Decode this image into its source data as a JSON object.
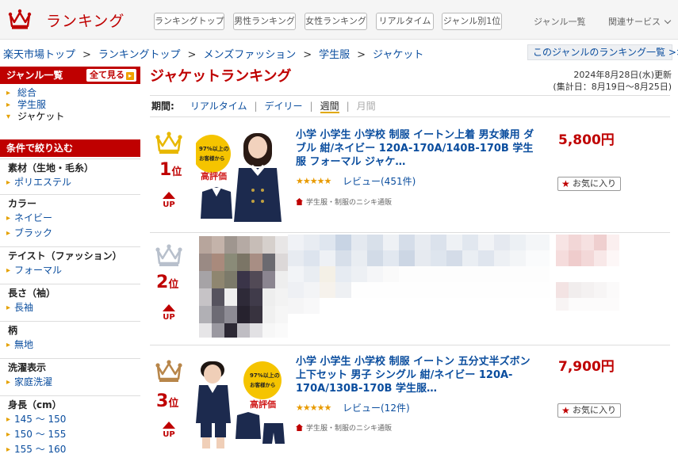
{
  "header": {
    "logo_text": "ランキング",
    "nav_buttons": [
      "ランキングトップ",
      "男性ランキング",
      "女性ランキング",
      "リアルタイム",
      "ジャンル別1位"
    ],
    "nav_links": [
      "ジャンル一覧",
      "関連サービス"
    ]
  },
  "breadcrumb": {
    "items": [
      "楽天市場トップ",
      "ランキングトップ",
      "メンズファッション",
      "学生服",
      "ジャケット"
    ],
    "separator": ">",
    "genre_ranking_link": "このジャンルのランキング一覧 >>"
  },
  "sidebar": {
    "genre_header": "ジャンル一覧",
    "see_all": "全て見る",
    "genres": [
      "総合",
      "学生服",
      "ジャケット"
    ],
    "filter_header": "条件で絞り込む",
    "filters": [
      {
        "title": "素材（生地・毛糸）",
        "options": [
          "ポリエステル"
        ]
      },
      {
        "title": "カラー",
        "options": [
          "ネイビー",
          "ブラック"
        ]
      },
      {
        "title": "テイスト（ファッション）",
        "options": [
          "フォーマル"
        ]
      },
      {
        "title": "長さ（袖）",
        "options": [
          "長袖"
        ]
      },
      {
        "title": "柄",
        "options": [
          "無地"
        ]
      },
      {
        "title": "洗濯表示",
        "options": [
          "家庭洗濯"
        ]
      },
      {
        "title": "身長（cm）",
        "options": [
          "145 ～ 150",
          "150 ～ 155",
          "155 ～ 160"
        ]
      }
    ]
  },
  "main": {
    "title": "ジャケットランキング",
    "updated": "2024年8月28日(水)更新",
    "period_note": "(集計日：8月19日～8月25日)",
    "period_label": "期間:",
    "periods": [
      "リアルタイム",
      "デイリー",
      "週間",
      "月間"
    ],
    "items": [
      {
        "rank": "1",
        "rank_suffix": "位",
        "trend": "UP",
        "name": "小学 小学生 小学校 制服 イートン上着 男女兼用 ダブル 紺/ネイビー 120A-170A/140B-170B 学生服 フォーマル ジャケ…",
        "price": "5,800円",
        "stars": "★★★★★",
        "reviews": "レビュー(451件)",
        "shop": "学生服・制服のニシキ通販",
        "fav": "お気に入り",
        "thumb_badge_top": "97%以上の",
        "thumb_badge_mid": "お客様から",
        "thumb_badge_big": "高評価"
      },
      {
        "rank": "2",
        "rank_suffix": "位",
        "trend": "UP"
      },
      {
        "rank": "3",
        "rank_suffix": "位",
        "trend": "UP",
        "name": "小学 小学生 小学校 制服 イートン 五分丈半ズボン上下セット 男子 シングル 紺/ネイビー 120A-170A/130B-170B 学生服…",
        "price": "7,900円",
        "stars": "★★★★★",
        "reviews": "レビュー(12件)",
        "shop": "学生服・制服のニシキ通販",
        "fav": "お気に入り",
        "thumb_badge_top": "97%以上の",
        "thumb_badge_mid": "お客様から",
        "thumb_badge_big": "高評価"
      }
    ]
  },
  "colors": {
    "accent": "#bf0000",
    "link": "#0a4d9e",
    "gold": "#e8b800",
    "silver": "#b8c0cc",
    "bronze": "#b8864a"
  },
  "icons": [
    "crown-icon",
    "up-arrow-icon",
    "shop-house-icon",
    "star-icon",
    "chevron-down-icon"
  ]
}
